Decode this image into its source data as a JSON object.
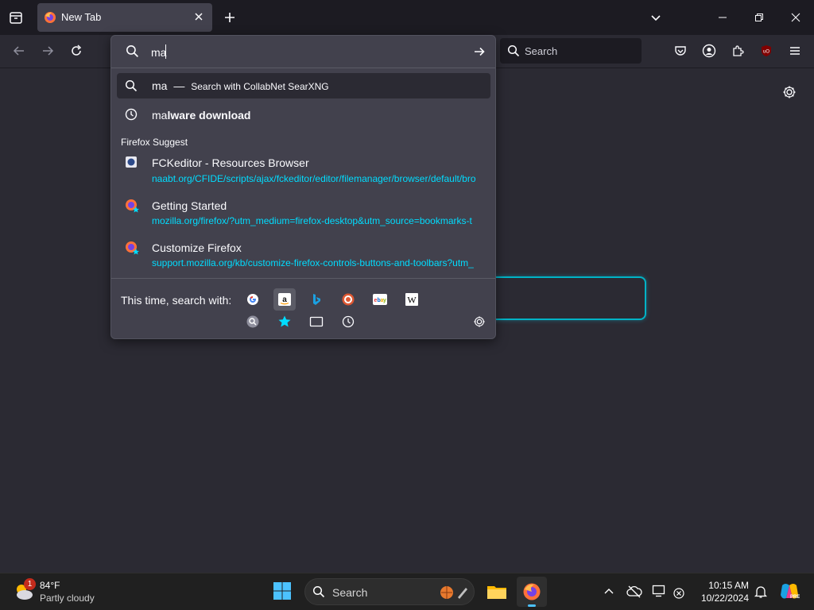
{
  "tab": {
    "title": "New Tab"
  },
  "toolbar": {
    "search_placeholder": "Search"
  },
  "urlbar": {
    "value": "ma",
    "search_suggestion": {
      "query": "ma",
      "separator": "—",
      "action": "Search with CollabNet SearXNG"
    },
    "history_suggestion": {
      "typed": "ma",
      "completion": "lware download"
    },
    "group_label": "Firefox Suggest",
    "results": [
      {
        "title": "FCKeditor - Resources Browser",
        "url": "naabt.org/CFIDE/scripts/ajax/fckeditor/editor/filemanager/browser/default/bro"
      },
      {
        "title": "Getting Started",
        "url": "mozilla.org/firefox/?utm_medium=firefox-desktop&utm_source=bookmarks-t"
      },
      {
        "title": "Customize Firefox",
        "url": "support.mozilla.org/kb/customize-firefox-controls-buttons-and-toolbars?utm_"
      }
    ],
    "one_off_label": "This time, search with:",
    "engines": [
      "google-icon",
      "amazon-icon",
      "bing-icon",
      "duckduckgo-icon",
      "ebay-icon",
      "wikipedia-icon",
      "searxng-icon",
      "bookmarks-icon",
      "tabs-icon",
      "history-icon"
    ]
  },
  "taskbar": {
    "weather": {
      "temp": "84°F",
      "condition": "Partly cloudy",
      "badge": "1"
    },
    "search_placeholder": "Search",
    "time": "10:15 AM",
    "date": "10/22/2024"
  },
  "colors": {
    "accent": "#00ddff",
    "popup_bg": "#42414d",
    "chrome_bg": "#1c1b22",
    "page_bg": "#2b2a33"
  }
}
